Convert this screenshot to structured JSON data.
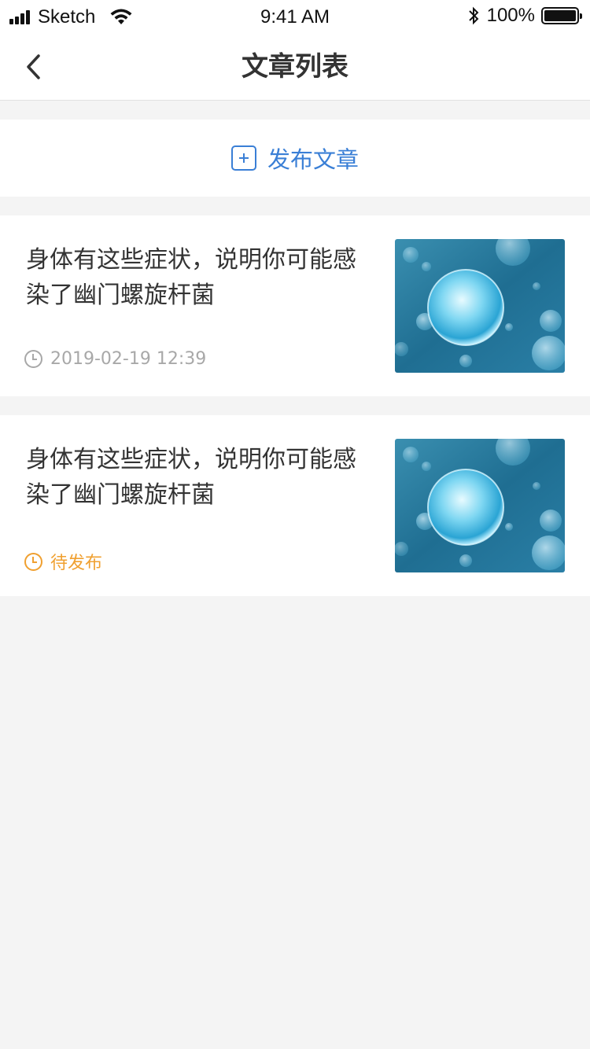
{
  "status_bar": {
    "carrier": "Sketch",
    "time": "9:41 AM",
    "battery": "100%"
  },
  "nav": {
    "title": "文章列表",
    "back_icon": "chevron-left-icon"
  },
  "publish": {
    "label": "发布文章",
    "icon": "plus-square-icon",
    "color": "#3a7fd6"
  },
  "articles": [
    {
      "title": "身体有这些症状，说明你可能感染了幽门螺旋杆菌",
      "meta": "2019-02-19 12:39",
      "meta_color": "#a8a8a8",
      "image": "bacteria-cell-thumbnail"
    },
    {
      "title": "身体有这些症状，说明你可能感染了幽门螺旋杆菌",
      "meta": "待发布",
      "meta_color": "#f0a030",
      "image": "bacteria-cell-thumbnail"
    }
  ]
}
